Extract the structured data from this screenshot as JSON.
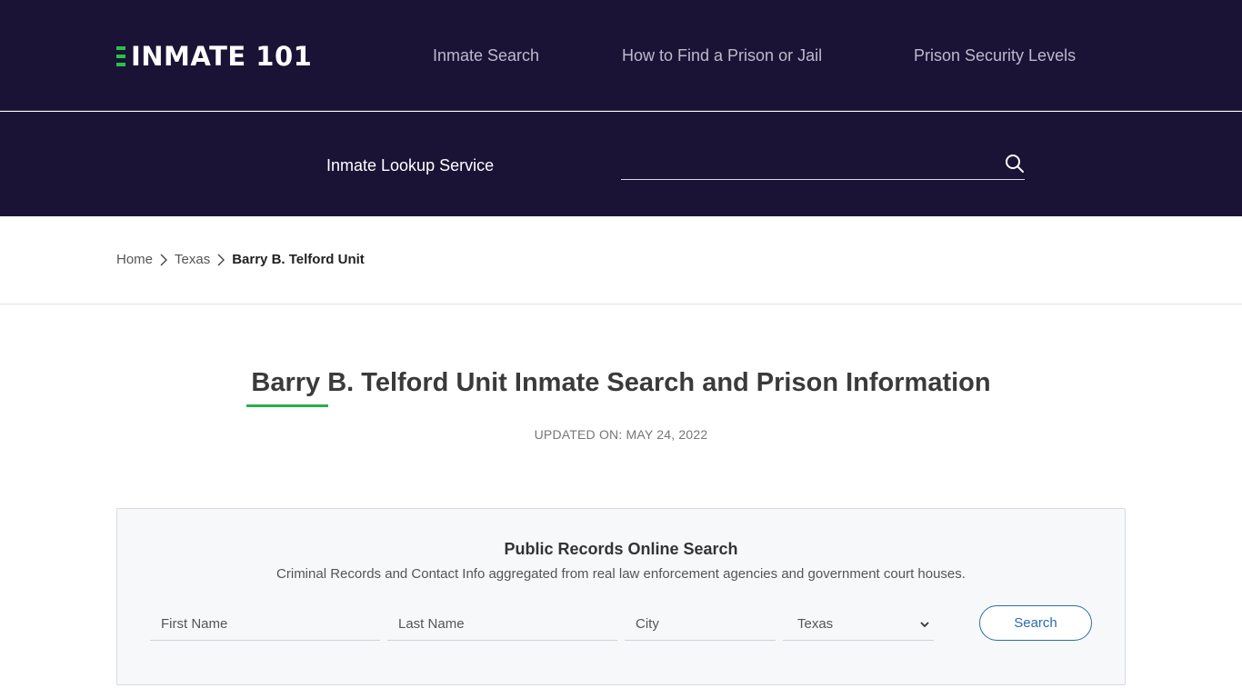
{
  "header": {
    "logo_text": "INMATE 101",
    "nav": [
      {
        "label": "Inmate Search"
      },
      {
        "label": "How to Find a Prison or Jail"
      },
      {
        "label": "Prison Security Levels"
      }
    ]
  },
  "lookup": {
    "label": "Inmate Lookup Service",
    "input_value": "",
    "icon": "search-icon"
  },
  "breadcrumb": {
    "home": "Home",
    "state": "Texas",
    "current": "Barry B. Telford Unit"
  },
  "page": {
    "title": "Barry B. Telford Unit Inmate Search and Prison Information",
    "updated": "UPDATED ON: MAY 24, 2022"
  },
  "records": {
    "title": "Public Records Online Search",
    "subtitle": "Criminal Records and Contact Info aggregated from real law enforcement agencies and government court houses.",
    "first_name_placeholder": "First Name",
    "last_name_placeholder": "Last Name",
    "city_placeholder": "City",
    "state_selected": "Texas",
    "search_label": "Search"
  },
  "colors": {
    "header_bg": "#1b1336",
    "accent_green": "#27b04a",
    "button_blue": "#2b6cb0"
  }
}
